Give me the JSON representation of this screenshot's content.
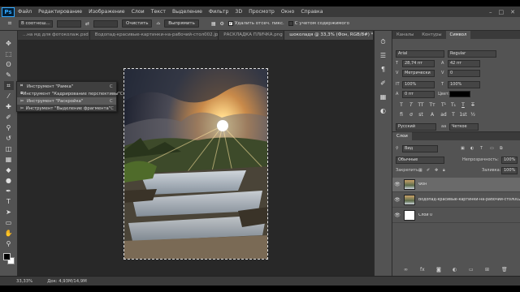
{
  "app": {
    "logo": "Ps"
  },
  "menu": [
    "Файл",
    "Редактирование",
    "Изображение",
    "Слои",
    "Текст",
    "Выделение",
    "Фильтр",
    "3D",
    "Просмотр",
    "Окно",
    "Справка"
  ],
  "window_controls": [
    "–",
    "□",
    "✕"
  ],
  "options_bar": {
    "ratio_select": "В соотнош...",
    "clear_button": "Очистить",
    "straighten_label": "Выпрямить",
    "delete_crop_label": "Удалить отсеч. пикс.",
    "content_aware_label": "С учетом содержимого",
    "delete_crop_checked": true,
    "content_aware_checked": false
  },
  "tabs": [
    {
      "label": "...на мд для фотоколаж.psd",
      "active": false
    },
    {
      "label": "Водопад-красивые-картинки-на-рабочий-стол002.jpg",
      "active": false
    },
    {
      "label": "РАСКЛАДКА ПЛИЧКА.png",
      "active": false
    },
    {
      "label": "шоколадя @ 33,3% (Фон, RGB/8#) *",
      "active": true
    }
  ],
  "tools": [
    {
      "name": "move-tool-icon",
      "glyph": "✥"
    },
    {
      "name": "marquee-tool-icon",
      "glyph": "⬚"
    },
    {
      "name": "lasso-tool-icon",
      "glyph": "ʘ"
    },
    {
      "name": "quick-select-tool-icon",
      "glyph": "✎"
    },
    {
      "name": "crop-tool-icon",
      "glyph": "⌗"
    },
    {
      "name": "eyedropper-tool-icon",
      "glyph": "⁄"
    },
    {
      "name": "healing-tool-icon",
      "glyph": "✚"
    },
    {
      "name": "brush-tool-icon",
      "glyph": "✐"
    },
    {
      "name": "stamp-tool-icon",
      "glyph": "⚲"
    },
    {
      "name": "history-brush-icon",
      "glyph": "↺"
    },
    {
      "name": "eraser-tool-icon",
      "glyph": "◫"
    },
    {
      "name": "gradient-tool-icon",
      "glyph": "▦"
    },
    {
      "name": "blur-tool-icon",
      "glyph": "◆"
    },
    {
      "name": "dodge-tool-icon",
      "glyph": "●"
    },
    {
      "name": "pen-tool-icon",
      "glyph": "✒"
    },
    {
      "name": "type-tool-icon",
      "glyph": "T"
    },
    {
      "name": "path-select-tool-icon",
      "glyph": "➤"
    },
    {
      "name": "shape-tool-icon",
      "glyph": "▭"
    },
    {
      "name": "hand-tool-icon",
      "glyph": "✋"
    },
    {
      "name": "zoom-tool-icon",
      "glyph": "⚲"
    }
  ],
  "flyout": [
    {
      "icon": "crop-icon",
      "glyph": "⌗",
      "label": "Инструмент \"Рамка\"",
      "key": "C",
      "highlighted": false
    },
    {
      "icon": "perspective-crop-icon",
      "glyph": "⧈",
      "label": "Инструмент \"Кадрирование перспективы\"",
      "key": "C",
      "highlighted": false
    },
    {
      "icon": "slice-icon",
      "glyph": "✂",
      "label": "Инструмент \"Раскройка\"",
      "key": "C",
      "highlighted": true
    },
    {
      "icon": "slice-select-icon",
      "glyph": "✂",
      "label": "Инструмент \"Выделение фрагмента\"",
      "key": "C",
      "highlighted": false
    }
  ],
  "status": {
    "zoom": "33,33%",
    "doc": "Док: 4,93М/14,9М"
  },
  "char_panel": {
    "tabs": [
      {
        "label": "Каналы",
        "active": false
      },
      {
        "label": "Контуры",
        "active": false
      },
      {
        "label": "Символ",
        "active": true
      }
    ],
    "font_family": "Arial",
    "font_style": "Regular",
    "font_size": "28,74 пт",
    "leading": "42 пт",
    "kerning": "Метрически",
    "tracking": "0",
    "v_scale": "100%",
    "h_scale": "100%",
    "baseline": "0 пт",
    "color_label": "Цвет:",
    "color_value": "#000000",
    "language": "Русский",
    "antialias": "Четкое"
  },
  "layers_panel": {
    "title": "Слои",
    "kind_filter": "Вид",
    "blend_mode": "Обычные",
    "opacity_label": "Непрозрачность:",
    "opacity": "100%",
    "lock_label": "Закрепить:",
    "fill_label": "Заливка:",
    "fill": "100%",
    "layers": [
      {
        "name": "Фон",
        "selected": true,
        "thumb": "photo"
      },
      {
        "name": "Водопад-красивые-картинки-на-рабочий-стол002",
        "selected": false,
        "thumb": "photo"
      },
      {
        "name": "Слой 0",
        "selected": false,
        "thumb": "white"
      }
    ]
  }
}
